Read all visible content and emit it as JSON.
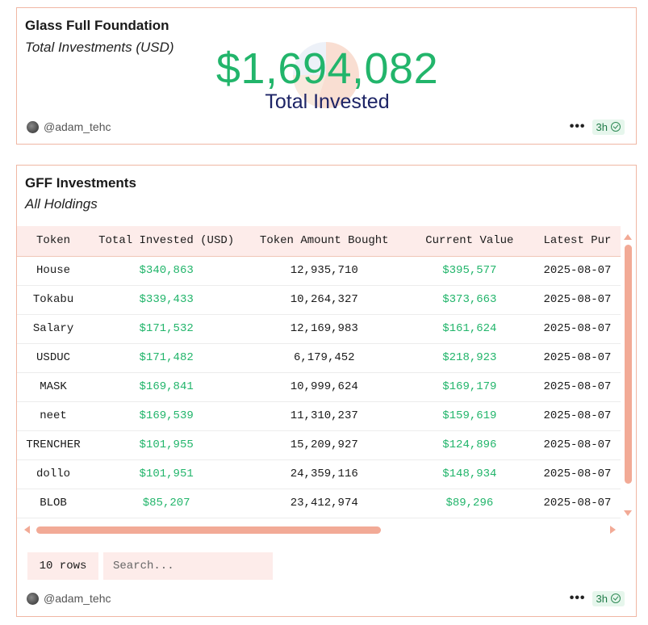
{
  "summary_card": {
    "title": "Glass Full Foundation",
    "subtitle": "Total Investments (USD)",
    "value": "$1,694,082",
    "value_label": "Total Invested",
    "author": "@adam_tehc",
    "more": "•••",
    "time": "3h"
  },
  "table_card": {
    "title": "GFF Investments",
    "subtitle": "All Holdings",
    "columns": [
      "Token",
      "Total Invested (USD)",
      "Token Amount Bought",
      "Current Value",
      "Latest Pur"
    ],
    "rows": [
      [
        "House",
        "$340,863",
        "12,935,710",
        "$395,577",
        "2025-08-07"
      ],
      [
        "Tokabu",
        "$339,433",
        "10,264,327",
        "$373,663",
        "2025-08-07"
      ],
      [
        "Salary",
        "$171,532",
        "12,169,983",
        "$161,624",
        "2025-08-07"
      ],
      [
        "USDUC",
        "$171,482",
        "6,179,452",
        "$218,923",
        "2025-08-07"
      ],
      [
        "MASK",
        "$169,841",
        "10,999,624",
        "$169,179",
        "2025-08-07"
      ],
      [
        "neet",
        "$169,539",
        "11,310,237",
        "$159,619",
        "2025-08-07"
      ],
      [
        "TRENCHER",
        "$101,955",
        "15,209,927",
        "$124,896",
        "2025-08-07"
      ],
      [
        "dollo",
        "$101,951",
        "24,359,116",
        "$148,934",
        "2025-08-07"
      ],
      [
        "BLOB",
        "$85,207",
        "23,412,974",
        "$89,296",
        "2025-08-07"
      ]
    ],
    "rows_select": "10 rows",
    "search_placeholder": "Search...",
    "author": "@adam_tehc",
    "more": "•••",
    "time": "3h"
  },
  "colors": {
    "accent_green": "#22b56b",
    "border_peach": "#f0b7a4",
    "header_bg": "#fdecea",
    "label_navy": "#1d2466"
  }
}
